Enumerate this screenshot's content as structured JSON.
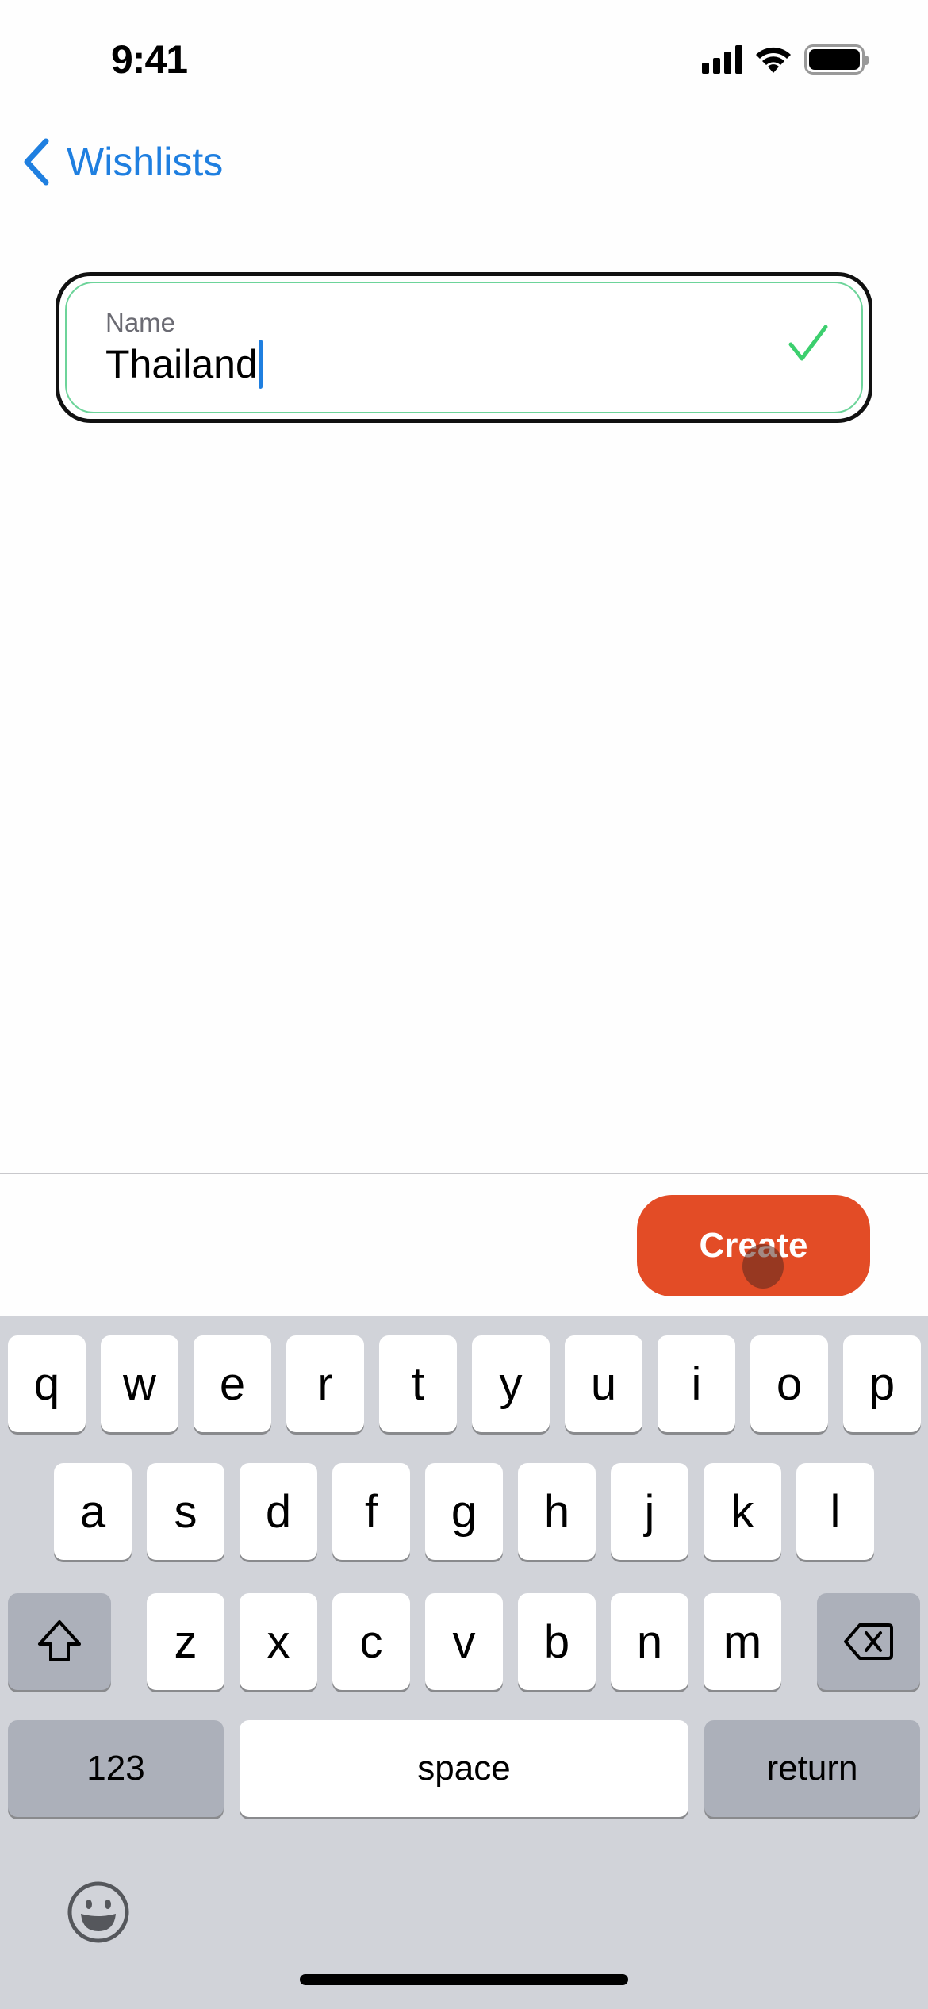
{
  "status_bar": {
    "time": "9:41",
    "icons": [
      "cellular-signal-icon",
      "wifi-icon",
      "battery-icon"
    ]
  },
  "nav": {
    "back_label": "Wishlists",
    "back_icon": "chevron-left-icon"
  },
  "name_field": {
    "label": "Name",
    "value": "Thailand",
    "valid": true,
    "valid_icon": "checkmark-icon"
  },
  "actions": {
    "create_label": "Create"
  },
  "keyboard": {
    "row1": [
      "q",
      "w",
      "e",
      "r",
      "t",
      "y",
      "u",
      "i",
      "o",
      "p"
    ],
    "row2": [
      "a",
      "s",
      "d",
      "f",
      "g",
      "h",
      "j",
      "k",
      "l"
    ],
    "row3": [
      "z",
      "x",
      "c",
      "v",
      "b",
      "n",
      "m"
    ],
    "shift_icon": "shift-icon",
    "delete_icon": "delete-backspace-icon",
    "numbers_label": "123",
    "space_label": "space",
    "return_label": "return",
    "emoji_icon": "emoji-icon"
  },
  "colors": {
    "accent": "#1f7fe0",
    "create_button": "#e34c26",
    "valid_green": "#3ccf6e",
    "keyboard_bg": "#d1d3d9",
    "dark_key": "#acb0ba"
  }
}
